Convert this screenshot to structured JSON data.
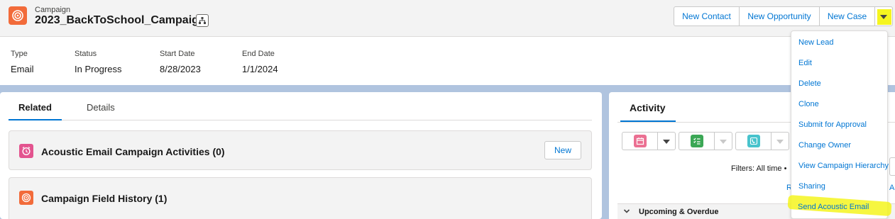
{
  "header": {
    "object_label": "Campaign",
    "record_title": "2023_BackToSchool_Campaign",
    "icon": "campaign-icon",
    "hierarchy_icon": "hierarchy-icon",
    "actions": {
      "new_contact": "New Contact",
      "new_opportunity": "New Opportunity",
      "new_case": "New Case"
    },
    "highlight_color": "#f5f520"
  },
  "highlights": {
    "fields": [
      {
        "label": "Type",
        "value": "Email"
      },
      {
        "label": "Status",
        "value": "In Progress"
      },
      {
        "label": "Start Date",
        "value": "8/28/2023"
      },
      {
        "label": "End Date",
        "value": "1/1/2024"
      }
    ]
  },
  "tabs": {
    "related": "Related",
    "details": "Details"
  },
  "related_lists": [
    {
      "title": "Acoustic Email Campaign Activities (0)",
      "icon": "alarm-clock-icon",
      "icon_color": "#e3548f",
      "button": "New"
    },
    {
      "title": "Campaign Field History (1)",
      "icon": "campaign-icon",
      "icon_color": "#f26b3a"
    }
  ],
  "activity": {
    "tab": "Activity",
    "publishers": [
      {
        "icon": "event-icon",
        "color": "#eb7092"
      },
      {
        "icon": "task-icon",
        "color": "#3ba755"
      },
      {
        "icon": "call-icon",
        "color": "#48c3cc"
      }
    ],
    "filters_text": "Filters: All time • ",
    "refresh_link": "R",
    "all_link": "All",
    "section_upcoming": "Upcoming & Overdue"
  },
  "dropdown_menu": {
    "items": [
      "New Lead",
      "Edit",
      "Delete",
      "Clone",
      "Submit for Approval",
      "Change Owner",
      "View Campaign Hierarchy",
      "Sharing",
      "Send Acoustic Email"
    ]
  },
  "colors": {
    "brand_blue": "#0176d3",
    "page_bg": "#b0c4df"
  }
}
